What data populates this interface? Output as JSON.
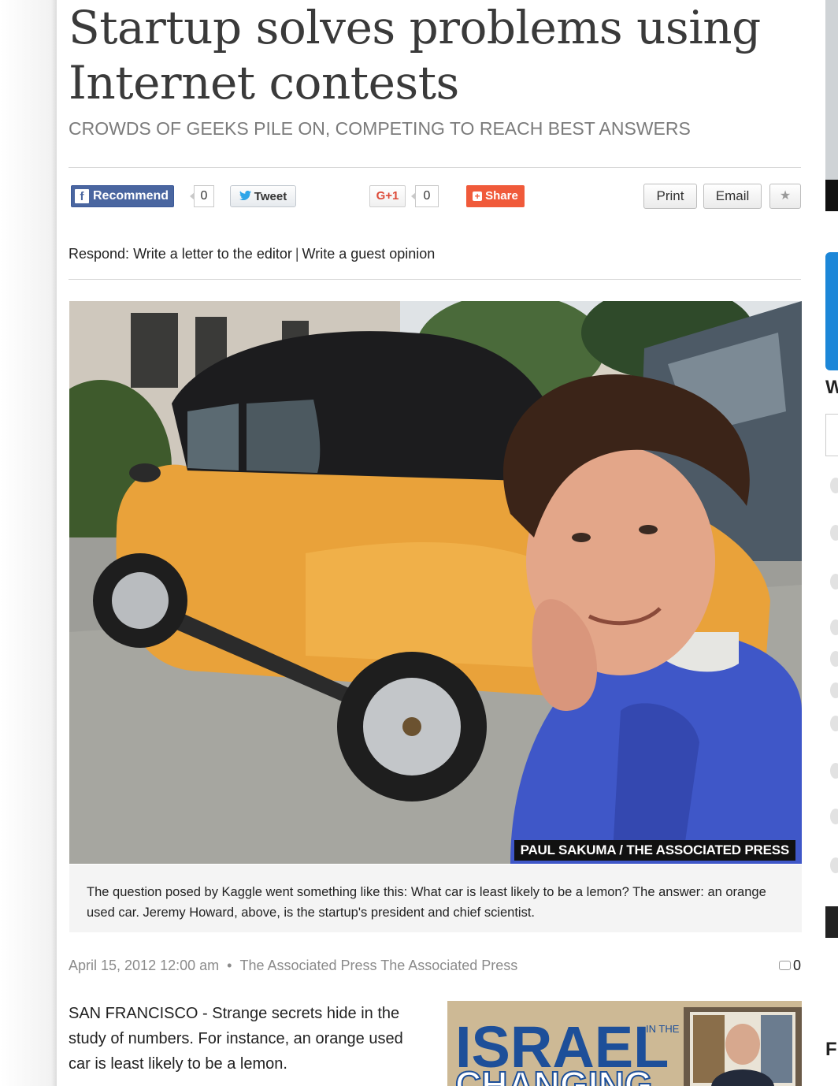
{
  "article": {
    "headline": "Startup solves problems using Internet contests",
    "subhead": "CROWDS OF GEEKS PILE ON, COMPETING TO REACH BEST ANSWERS"
  },
  "share_bar": {
    "recommend_label": "Recommend",
    "recommend_count": "0",
    "tweet_label": "Tweet",
    "gplus_label": "G+1",
    "gplus_count": "0",
    "share_label": "Share",
    "print_label": "Print",
    "email_label": "Email",
    "star_glyph": "★"
  },
  "respond": {
    "prefix": "Respond:",
    "letter_link": "Write a letter to the editor",
    "separator": "|",
    "guest_link": "Write a guest opinion"
  },
  "photo": {
    "credit": "PAUL SAKUMA / THE ASSOCIATED PRESS",
    "caption": "The question posed by Kaggle went something like this: What car is least likely to be a lemon? The answer: an orange used car. Jeremy Howard, above, is the startup's president and chief scientist."
  },
  "meta": {
    "date": "April 15, 2012 12:00 am",
    "bullet": "•",
    "byline": "The Associated Press The Associated Press",
    "comment_count": "0"
  },
  "body": {
    "lead": "SAN FRANCISCO - Strange secrets hide in the study of numbers. For instance, an orange used car is least likely to be a lemon."
  },
  "ad": {
    "word1": "ISRAEL",
    "small": "IN THE",
    "word2": "CHANGING"
  },
  "right_rail": {
    "letter1": "W",
    "letter2": "F"
  },
  "colors": {
    "facebook": "#4a66a0",
    "twitter_bird": "#2ea5e8",
    "gplus": "#dd4b39",
    "share": "#f05a3a",
    "car_orange": "#e9a23a",
    "shirt_blue": "#3f57c8"
  }
}
